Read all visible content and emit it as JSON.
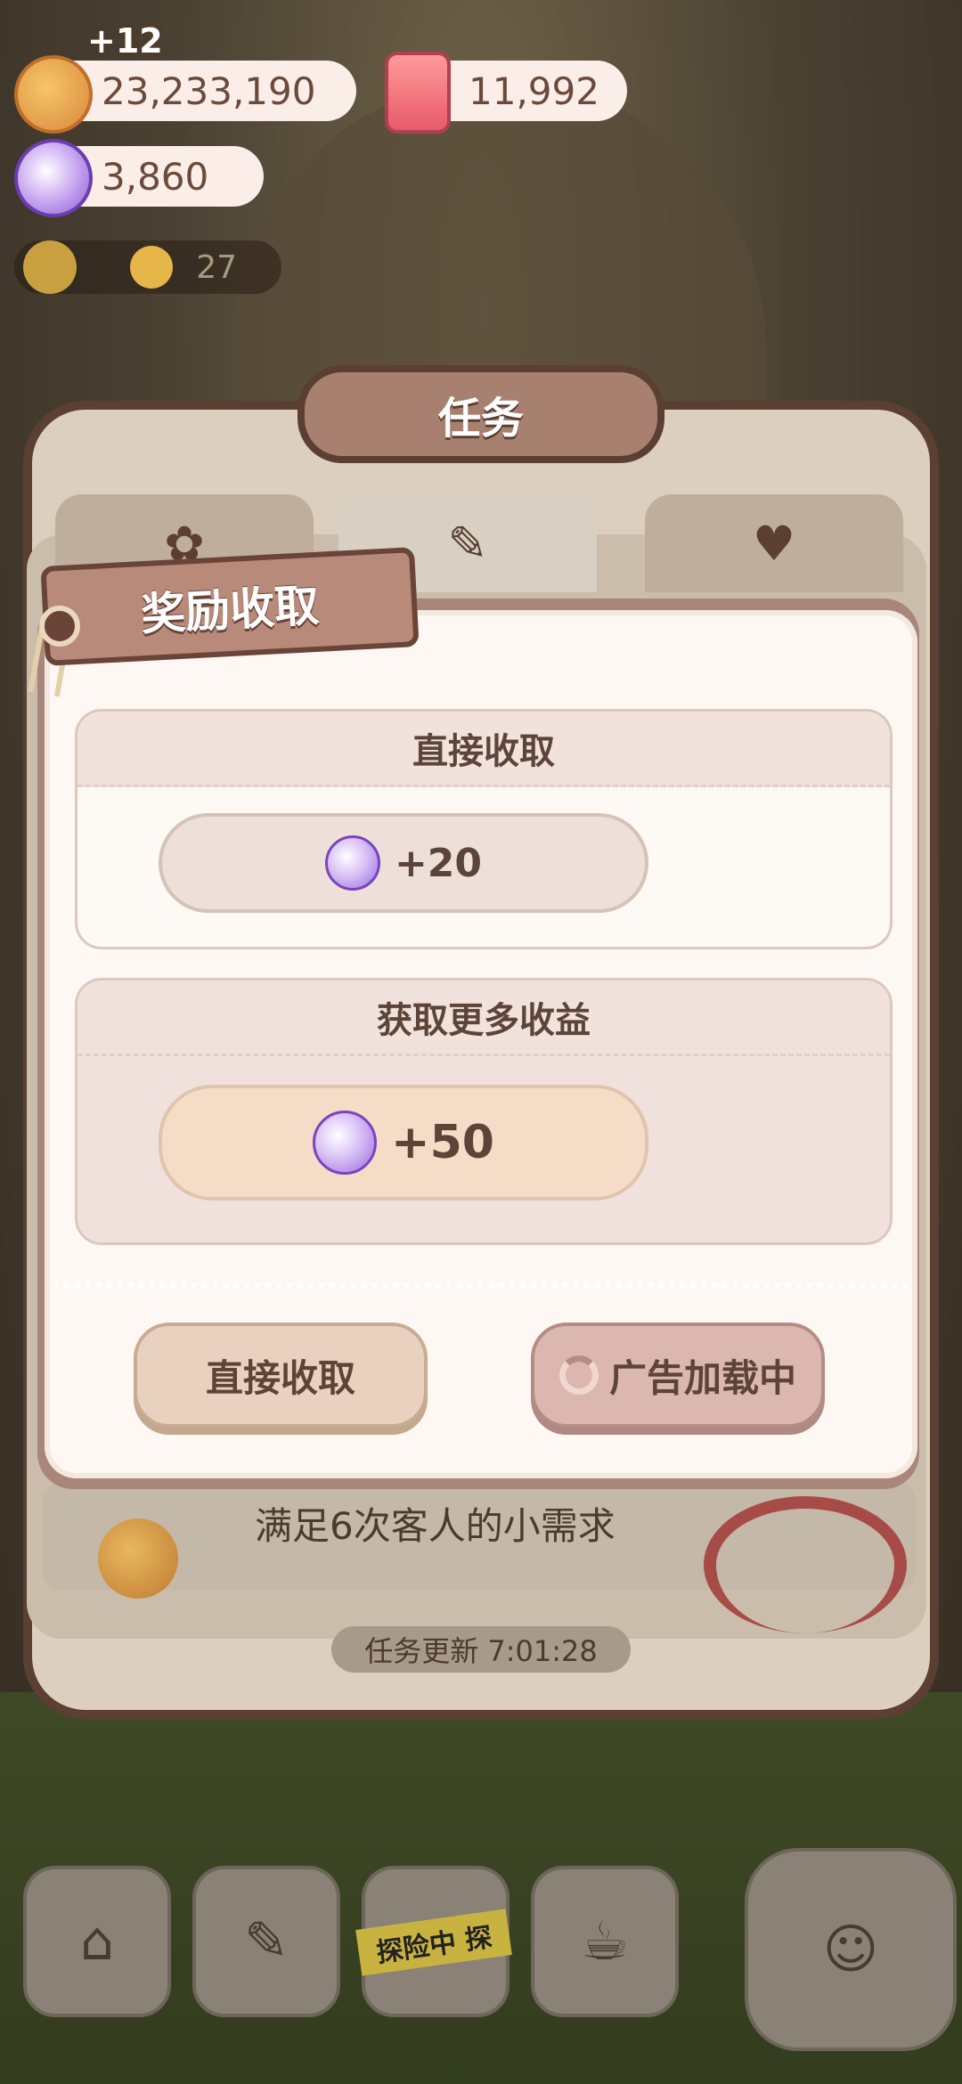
{
  "resources": {
    "gain_popup": "+12",
    "cookies": "23,233,190",
    "candles": "11,992",
    "gems": "3,860",
    "level_count": "27"
  },
  "mission_panel": {
    "title": "任务",
    "tabs": [
      {
        "icon": "paw-badge-icon"
      },
      {
        "icon": "note-heart-icon"
      },
      {
        "icon": "flask-heart-icon"
      }
    ],
    "mission_text": "满足6次客人的小需求",
    "refresh_label": "任务更新 7:01:28"
  },
  "reward_dialog": {
    "tag_title": "奖励收取",
    "direct": {
      "heading": "直接收取",
      "amount": "+20"
    },
    "more": {
      "heading": "获取更多收益",
      "amount": "+50"
    },
    "collect_button": "直接收取",
    "ad_button": "广告加载中"
  },
  "bottom_nav": {
    "adventure_tape": "探险中 探"
  },
  "colors": {
    "accent_brown": "#5c3f33",
    "dialog_bg": "#fdf8f3",
    "gem_purple": "#9a68e0"
  }
}
